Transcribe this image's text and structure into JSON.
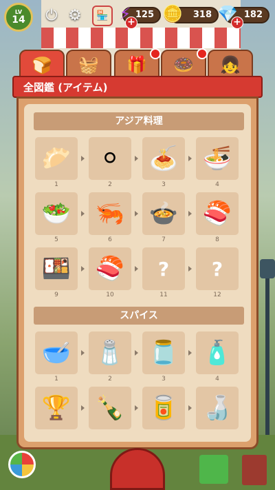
{
  "status": {
    "level_label": "LV",
    "level_value": "14",
    "energy": "125",
    "coins": "318",
    "gems": "182"
  },
  "album": {
    "title": "全図鑑 (アイテム)",
    "tabs": [
      {
        "icon": "bun-icon",
        "active": true,
        "badge": false
      },
      {
        "icon": "basket-icon",
        "active": false,
        "badge": false
      },
      {
        "icon": "gift-box-icon",
        "active": false,
        "badge": true
      },
      {
        "icon": "ring-icon",
        "active": false,
        "badge": true
      },
      {
        "icon": "character-icon",
        "active": false,
        "badge": false
      }
    ],
    "sections": [
      {
        "title": "アジア料理",
        "items": [
          {
            "num": "1",
            "icon": "dumpling-icon",
            "glyph": "🥟"
          },
          {
            "num": "2",
            "icon": "buns-icon",
            "glyph": "⚪"
          },
          {
            "num": "3",
            "icon": "noodles-icon",
            "glyph": "🍝"
          },
          {
            "num": "4",
            "icon": "ramen-icon",
            "glyph": "🍜"
          },
          {
            "num": "5",
            "icon": "bibimbap-icon",
            "glyph": "🥗"
          },
          {
            "num": "6",
            "icon": "shrimp-icon",
            "glyph": "🦐"
          },
          {
            "num": "7",
            "icon": "tofu-soup-icon",
            "glyph": "🍲"
          },
          {
            "num": "8",
            "icon": "sushi-roll-icon",
            "glyph": "🍣"
          },
          {
            "num": "9",
            "icon": "tamago-sushi-icon",
            "glyph": "🍱"
          },
          {
            "num": "10",
            "icon": "salmon-sushi-icon",
            "glyph": "🍣"
          },
          {
            "num": "11",
            "icon": "unknown-icon",
            "glyph": "?"
          },
          {
            "num": "12",
            "icon": "unknown-icon",
            "glyph": "?"
          }
        ]
      },
      {
        "title": "スパイス",
        "items": [
          {
            "num": "1",
            "icon": "flour-bowl-icon",
            "glyph": "🥣"
          },
          {
            "num": "2",
            "icon": "salt-shaker-icon",
            "glyph": "🧂"
          },
          {
            "num": "3",
            "icon": "red-sauce-icon",
            "glyph": "🫙"
          },
          {
            "num": "4",
            "icon": "sauce-bottle-icon",
            "glyph": "🧴"
          },
          {
            "num": "",
            "icon": "pepper-mill-icon",
            "glyph": "🏆"
          },
          {
            "num": "",
            "icon": "soy-sauce-icon",
            "glyph": "🍾"
          },
          {
            "num": "",
            "icon": "spice-can-icon",
            "glyph": "🥫"
          },
          {
            "num": "",
            "icon": "oil-bottle-icon",
            "glyph": "🍶"
          }
        ]
      }
    ]
  }
}
